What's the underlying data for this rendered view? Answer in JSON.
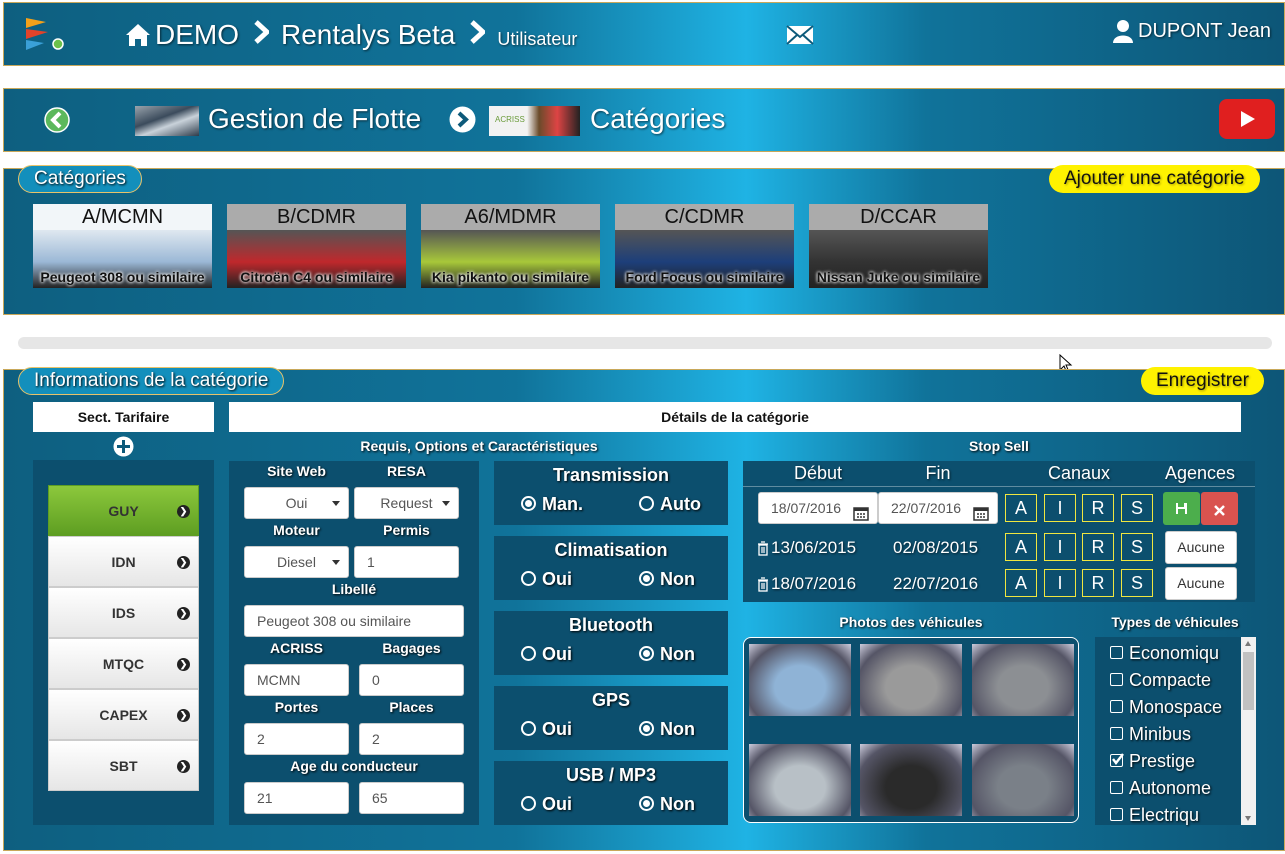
{
  "header": {
    "home": "DEMO",
    "crumb1": "Rentalys Beta",
    "crumb2": "Utilisateur",
    "user": "DUPONT Jean"
  },
  "subheader": {
    "section": "Gestion de Flotte",
    "page": "Catégories",
    "acriss_logo_text": "ACRISS"
  },
  "categories": {
    "title": "Catégories",
    "add_button": "Ajouter une catégorie",
    "cards": [
      {
        "code": "A/MCMN",
        "name": "Peugeot 308 ou similaire",
        "color": "#9bb8d6"
      },
      {
        "code": "B/CDMR",
        "name": "Citroën C4 ou similaire",
        "color": "#c0282c"
      },
      {
        "code": "A6/MDMR",
        "name": "Kia pikanto ou similaire",
        "color": "#a8c83a"
      },
      {
        "code": "C/CDMR",
        "name": "Ford Focus ou similaire",
        "color": "#1d3f7a"
      },
      {
        "code": "D/CCAR",
        "name": "Nissan Juke ou similaire",
        "color": "#333333"
      }
    ]
  },
  "info": {
    "title": "Informations de la catégorie",
    "save_button": "Enregistrer",
    "tarif_header": "Sect. Tarifaire",
    "details_header": "Détails de la catégorie",
    "tarifs": [
      "GUY",
      "IDN",
      "IDS",
      "MTQC",
      "CAPEX",
      "SBT"
    ]
  },
  "requis": {
    "title": "Requis, Options et Caractéristiques",
    "site_web_label": "Site Web",
    "site_web_value": "Oui",
    "resa_label": "RESA",
    "resa_value": "Request",
    "moteur_label": "Moteur",
    "moteur_value": "Diesel",
    "permis_label": "Permis",
    "permis_value": "1",
    "libelle_label": "Libellé",
    "libelle_value": "Peugeot 308 ou similaire",
    "acriss_label": "ACRISS",
    "acriss_value": "MCMN",
    "bagages_label": "Bagages",
    "bagages_value": "0",
    "portes_label": "Portes",
    "portes_value": "2",
    "places_label": "Places",
    "places_value": "2",
    "age_label": "Age du conducteur",
    "age_min": "21",
    "age_max": "65"
  },
  "options": [
    {
      "title": "Transmission",
      "a": "Man.",
      "b": "Auto",
      "selected": "a"
    },
    {
      "title": "Climatisation",
      "a": "Oui",
      "b": "Non",
      "selected": "b"
    },
    {
      "title": "Bluetooth",
      "a": "Oui",
      "b": "Non",
      "selected": "b"
    },
    {
      "title": "GPS",
      "a": "Oui",
      "b": "Non",
      "selected": "b"
    },
    {
      "title": "USB / MP3",
      "a": "Oui",
      "b": "Non",
      "selected": "b"
    }
  ],
  "stopsell": {
    "title": "Stop Sell",
    "col_debut": "Début",
    "col_fin": "Fin",
    "col_canaux": "Canaux",
    "col_agences": "Agences",
    "new_debut": "18/07/2016",
    "new_fin": "22/07/2016",
    "channels": [
      "A",
      "I",
      "R",
      "S"
    ],
    "rows": [
      {
        "debut": "13/06/2015",
        "fin": "02/08/2015",
        "agences": "Aucune"
      },
      {
        "debut": "18/07/2016",
        "fin": "22/07/2016",
        "agences": "Aucune"
      }
    ]
  },
  "photos": {
    "title": "Photos des véhicules",
    "colors": [
      "#8fb3d6",
      "#9a9a9a",
      "#8c8f93",
      "#b8c0c6",
      "#2a2a2a",
      "#7a8088"
    ]
  },
  "types": {
    "title": "Types de véhicules",
    "items": [
      {
        "label": "Economiqu",
        "checked": false
      },
      {
        "label": "Compacte",
        "checked": false
      },
      {
        "label": "Monospace",
        "checked": false
      },
      {
        "label": "Minibus",
        "checked": false
      },
      {
        "label": "Prestige",
        "checked": true
      },
      {
        "label": "Autonome",
        "checked": false
      },
      {
        "label": "Electriqu",
        "checked": false
      }
    ]
  }
}
